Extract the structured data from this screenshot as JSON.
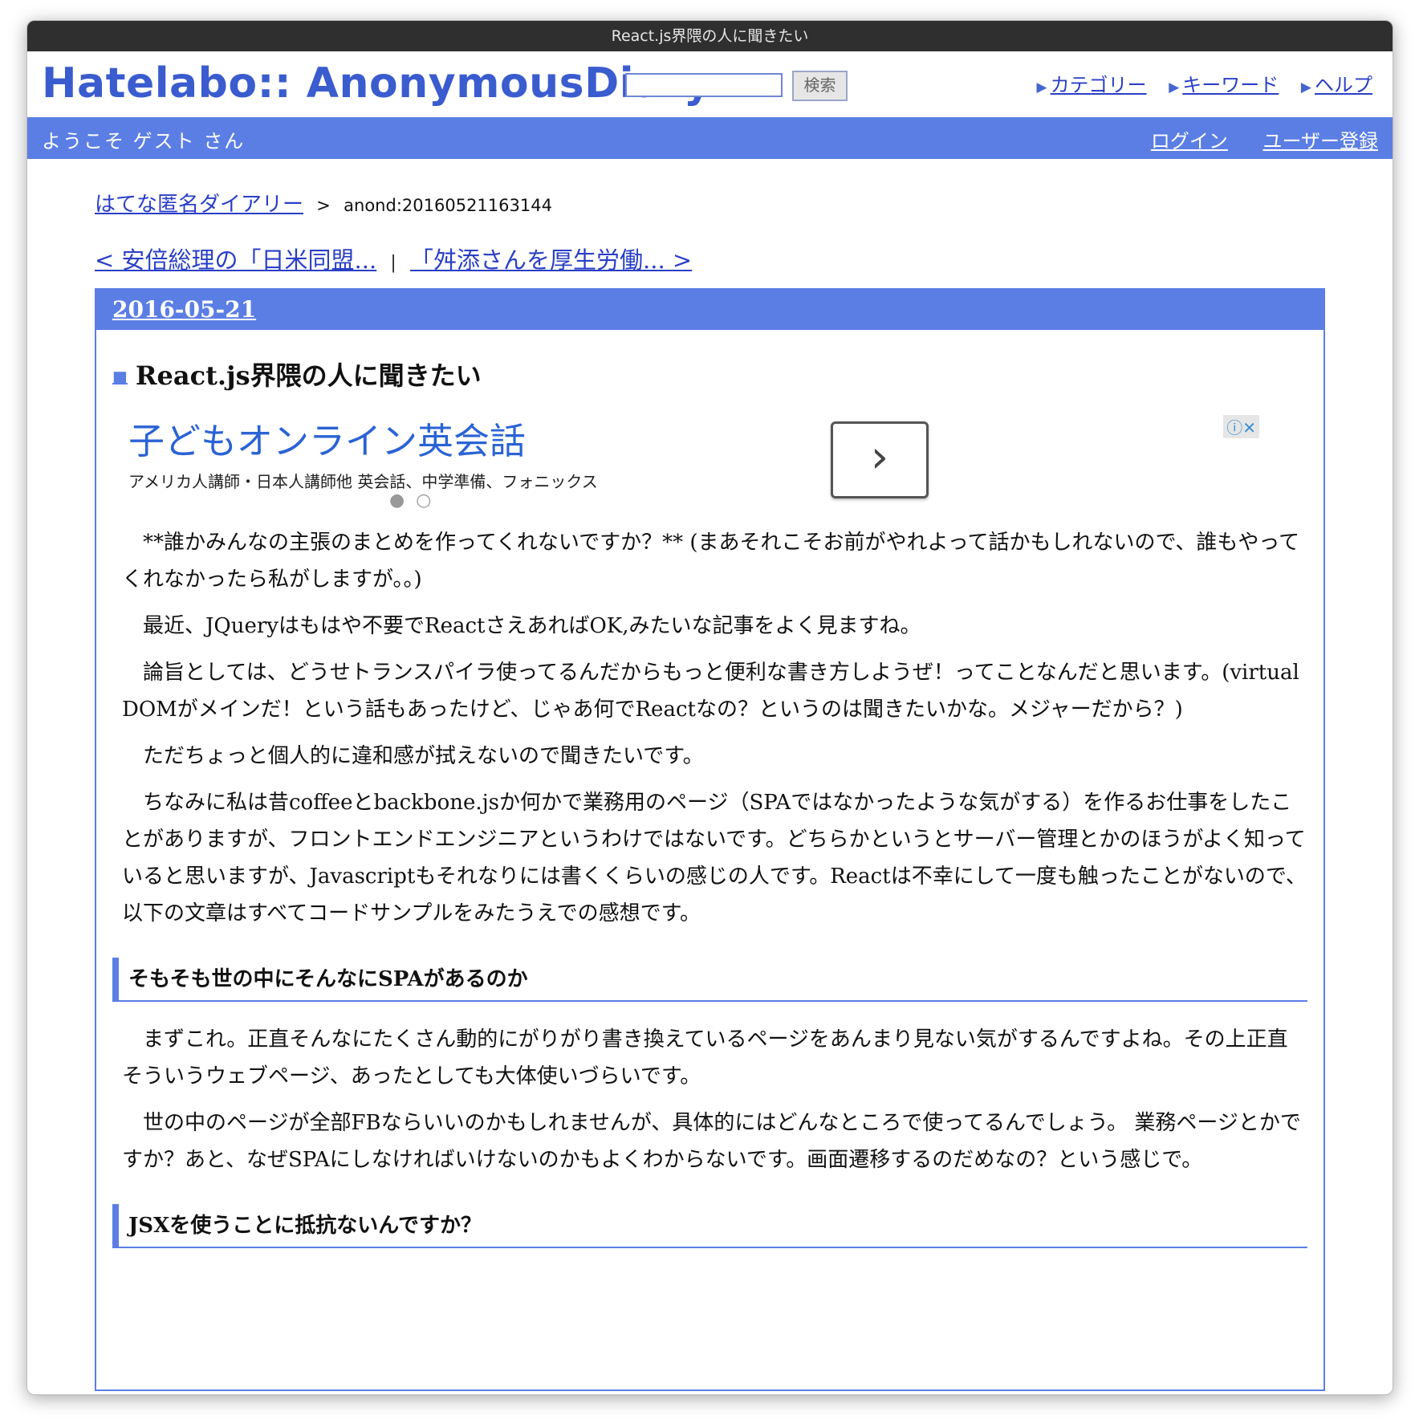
{
  "window": {
    "title": "React.js界隈の人に聞きたい"
  },
  "header": {
    "logo": "Hatelabo:: AnonymousDiary",
    "search_button": "検索",
    "links": [
      "カテゴリー",
      "キーワード",
      "ヘルプ"
    ]
  },
  "userbar": {
    "welcome": "ようこそ ゲスト さん",
    "login": "ログイン",
    "register": "ユーザー登録"
  },
  "breadcrumb": {
    "home": "はてな匿名ダイアリー",
    "separator": ">",
    "current": "anond:20160521163144"
  },
  "pager": {
    "prev": "< 安倍総理の「日米同盟...",
    "divider": "|",
    "next": "「舛添さんを厚生労働... >"
  },
  "entry": {
    "date": "2016-05-21",
    "title": "React.js界隈の人に聞きたい",
    "ad": {
      "title": "子どもオンライン英会話",
      "subtitle": "アメリカ人講師・日本人講師他 英会話、中学準備、フォニックス",
      "dots": "●○",
      "icons": "ⓘ✕"
    },
    "paragraphs": [
      "**誰かみんなの主張のまとめを作ってくれないですか？** (まあそれこそお前がやれよって話かもしれないので、誰もやってくれなかったら私がしますが。。)",
      "最近、JQueryはもはや不要でReactさえあればOK,みたいな記事をよく見ますね。",
      "論旨としては、どうせトランスパイラ使ってるんだからもっと便利な書き方しようぜ！ってことなんだと思います。(virtual DOMがメインだ！という話もあったけど、じゃあ何でReactなの？というのは聞きたいかな。メジャーだから？)",
      "ただちょっと個人的に違和感が拭えないので聞きたいです。",
      "ちなみに私は昔coffeeとbackbone.jsか何かで業務用のページ（SPAではなかったような気がする）を作るお仕事をしたことがありますが、フロントエンドエンジニアというわけではないです。どちらかというとサーバー管理とかのほうがよく知っていると思いますが、Javascriptもそれなりには書くくらいの感じの人です。Reactは不幸にして一度も触ったことがないので、以下の文章はすべてコードサンプルをみたうえでの感想です。"
    ],
    "sections": [
      {
        "heading": "そもそも世の中にそんなにSPAがあるのか",
        "paragraphs": [
          "まずこれ。正直そんなにたくさん動的にがりがり書き換えているページをあんまり見ない気がするんですよね。その上正直そういうウェブページ、あったとしても大体使いづらいです。",
          "世の中のページが全部FBならいいのかもしれませんが、具体的にはどんなところで使ってるんでしょう。 業務ページとかですか？あと、なぜSPAにしなければいけないのかもよくわからないです。画面遷移するのだめなの？という感じで。"
        ]
      },
      {
        "heading": "JSXを使うことに抵抗ないんですか？",
        "paragraphs": []
      }
    ]
  }
}
